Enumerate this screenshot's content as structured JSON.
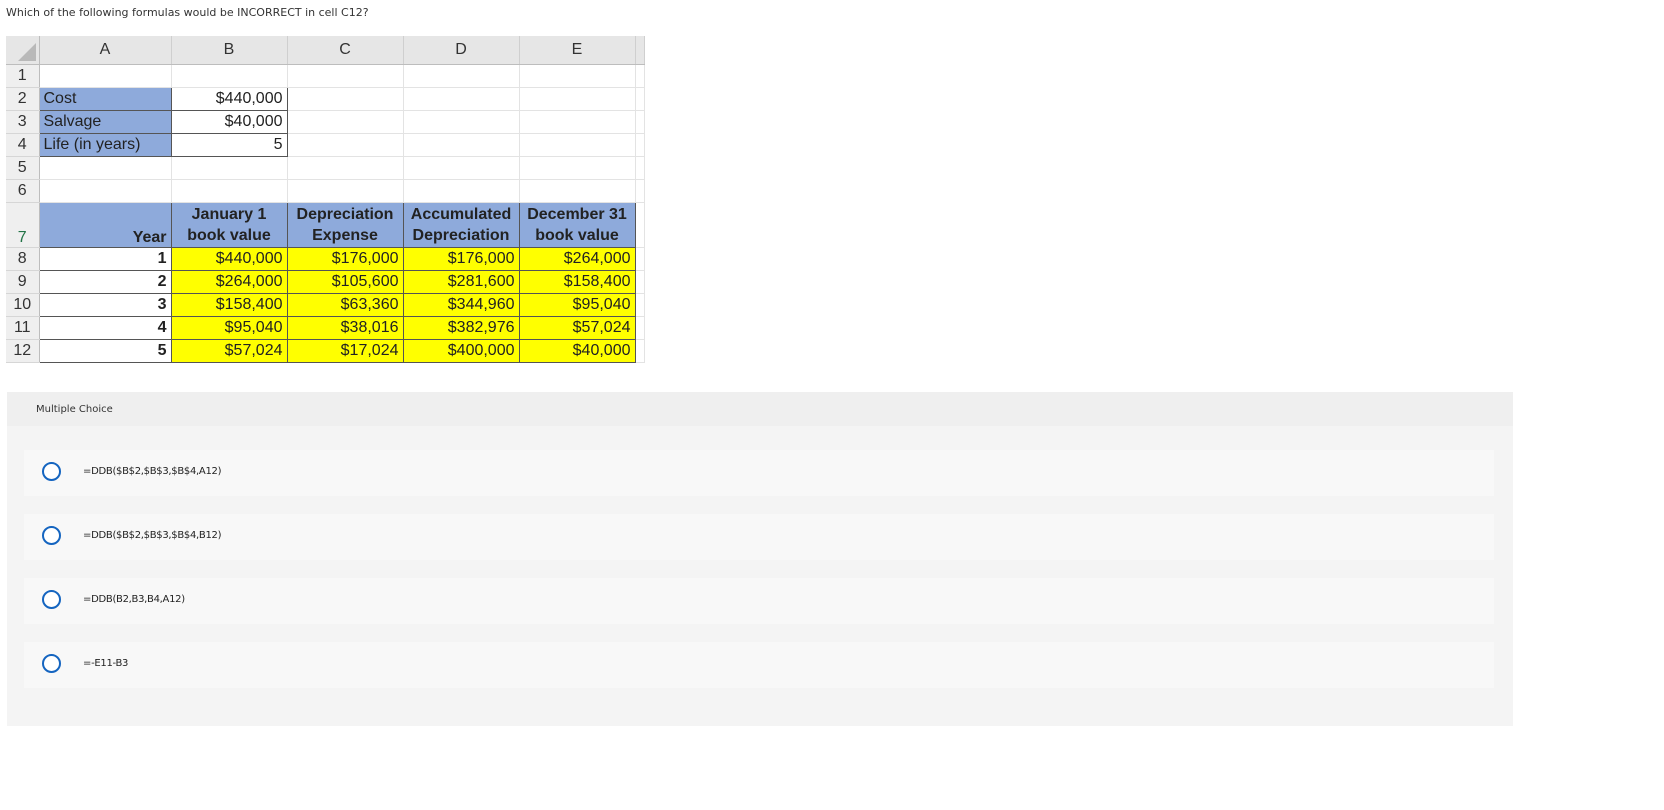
{
  "question": "Which of the following formulas would be INCORRECT in cell C12?",
  "sheet": {
    "columns": [
      "A",
      "B",
      "C",
      "D",
      "E"
    ],
    "rows": [
      "1",
      "2",
      "3",
      "4",
      "5",
      "6",
      "7",
      "8",
      "9",
      "10",
      "11",
      "12"
    ],
    "inputs": [
      {
        "label": "Cost",
        "value": "$440,000"
      },
      {
        "label": "Salvage",
        "value": "$40,000"
      },
      {
        "label": "Life (in years)",
        "value": "5"
      }
    ],
    "headers": {
      "year": "Year",
      "jan1": "January 1 book value",
      "dep": "Depreciation Expense",
      "accum": "Accumulated Depreciation",
      "dec31": "December 31 book value"
    },
    "data": [
      {
        "year": "1",
        "jan1": "$440,000",
        "dep": "$176,000",
        "accum": "$176,000",
        "dec31": "$264,000"
      },
      {
        "year": "2",
        "jan1": "$264,000",
        "dep": "$105,600",
        "accum": "$281,600",
        "dec31": "$158,400"
      },
      {
        "year": "3",
        "jan1": "$158,400",
        "dep": "$63,360",
        "accum": "$344,960",
        "dec31": "$95,040"
      },
      {
        "year": "4",
        "jan1": "$95,040",
        "dep": "$38,016",
        "accum": "$382,976",
        "dec31": "$57,024"
      },
      {
        "year": "5",
        "jan1": "$57,024",
        "dep": "$17,024",
        "accum": "$400,000",
        "dec31": "$40,000"
      }
    ],
    "colors": {
      "label_fill": "#8eaadb",
      "data_fill": "#ffff00"
    }
  },
  "multiple_choice": {
    "title": "Multiple Choice",
    "options": [
      "=DDB($B$2,$B$3,$B$4,A12)",
      "=DDB($B$2,$B$3,$B$4,B12)",
      "=DDB(B2,B3,B4,A12)",
      "=-E11-B3"
    ],
    "radio_color": "#1565c0"
  }
}
